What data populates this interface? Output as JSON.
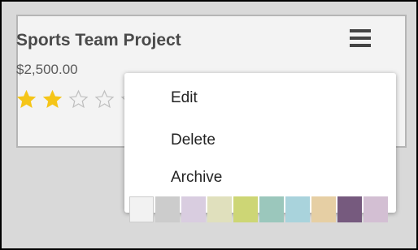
{
  "card": {
    "title": "Sports Team Project",
    "price": "$2,500.00",
    "rating": 2,
    "rating_max": 5,
    "star_color_filled": "#f5c518",
    "star_color_empty": "#bfbfbf"
  },
  "menu_icon": "hamburger-menu-icon",
  "dropdown": {
    "items": [
      {
        "label": "Edit"
      },
      {
        "label": "Delete"
      },
      {
        "label": "Archive"
      }
    ],
    "swatches": [
      "#f2f2f2",
      "#cccccc",
      "#d9cde0",
      "#e0e0bd",
      "#cdd675",
      "#9bc7bc",
      "#a9d3dc",
      "#e6cfa4",
      "#765a7e",
      "#d3bfd3"
    ]
  }
}
